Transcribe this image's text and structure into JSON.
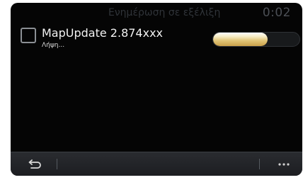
{
  "header": {
    "title": "Ενημέρωση σε εξέλιξη",
    "time": "0:02"
  },
  "update_item": {
    "name": "MapUpdate 2.874xxx",
    "status": "Λήψη...",
    "checked": false,
    "progress": 0.63
  },
  "toolbar": {
    "back_icon": "back-arrow-icon",
    "more_icon": "more-dots-icon"
  },
  "colors": {
    "screen_bg": "#050505",
    "progress_fill": "#e0c476",
    "toolbar_bg": "#25272b"
  }
}
